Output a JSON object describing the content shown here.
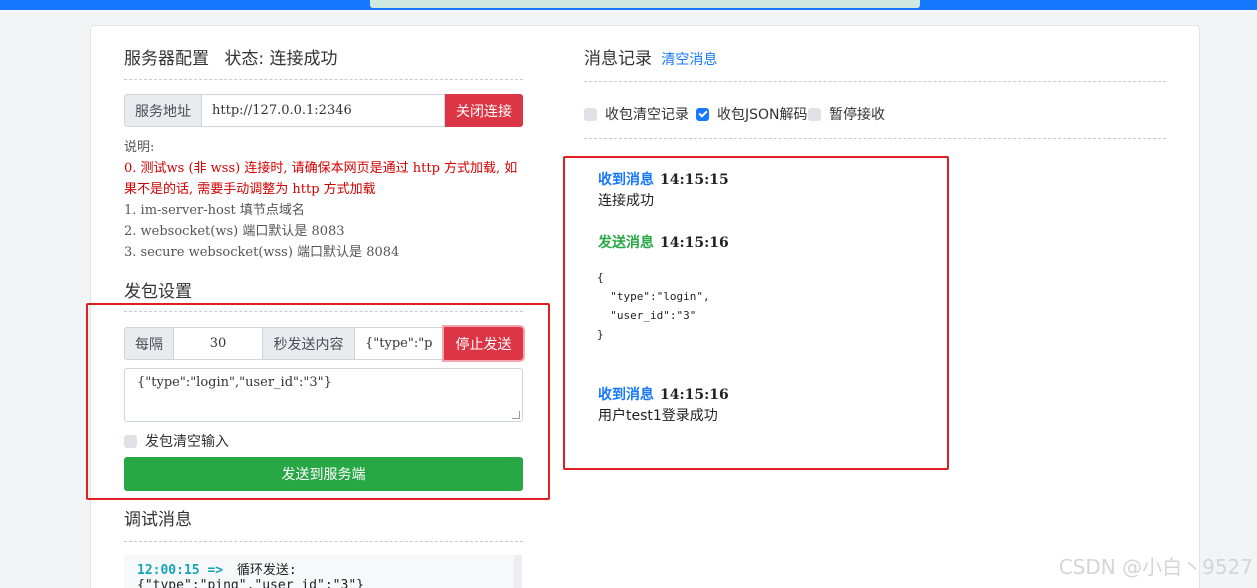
{
  "left": {
    "server_config_title": "服务器配置",
    "status_text": "状态: 连接成功",
    "server_addr_label": "服务地址",
    "server_addr_value": "http://127.0.0.1:2346",
    "close_btn": "关闭连接",
    "notes": {
      "heading": "说明:",
      "red_line": "0. 测试ws (非 wss) 连接时, 请确保本网页是通过 http 方式加载, 如果不是的话, 需要手动调整为 http 方式加载",
      "items": [
        "1. im-server-host 填节点域名",
        "2. websocket(ws) 端口默认是 8083",
        "3. secure websocket(wss) 端口默认是 8084"
      ]
    },
    "send_settings_title": "发包设置",
    "every_label": "每隔",
    "interval_value": "30",
    "sec_label": "秒发送内容",
    "content_preview": "{\"type\":\"p",
    "stop_btn": "停止发送",
    "textarea_value": "{\"type\":\"login\",\"user_id\":\"3\"}",
    "clear_input_label": "发包清空输入",
    "send_btn": "发送到服务端",
    "debug_title": "调试消息",
    "debug_line_time": "12:00:15 =>",
    "debug_line_text": "循环发送:",
    "debug_line_2": "{\"type\":\"ping\",\"user_id\":\"3\"}"
  },
  "right": {
    "title": "消息记录",
    "clear_link": "清空消息",
    "checkboxes": [
      {
        "label": "收包清空记录",
        "checked": false
      },
      {
        "label": "收包JSON解码",
        "checked": true
      },
      {
        "label": "暂停接收",
        "checked": false
      }
    ],
    "messages": [
      {
        "kind": "收到消息",
        "time": "14:15:15",
        "body": "连接成功"
      },
      {
        "kind": "发送消息",
        "time": "14:15:16",
        "json": [
          "{",
          "  \"type\":\"login\",",
          "  \"user_id\":\"3\"",
          "}"
        ]
      },
      {
        "kind": "收到消息",
        "time": "14:15:16",
        "body": "用户test1登录成功"
      }
    ]
  },
  "watermark": "CSDN @小白丶9527"
}
